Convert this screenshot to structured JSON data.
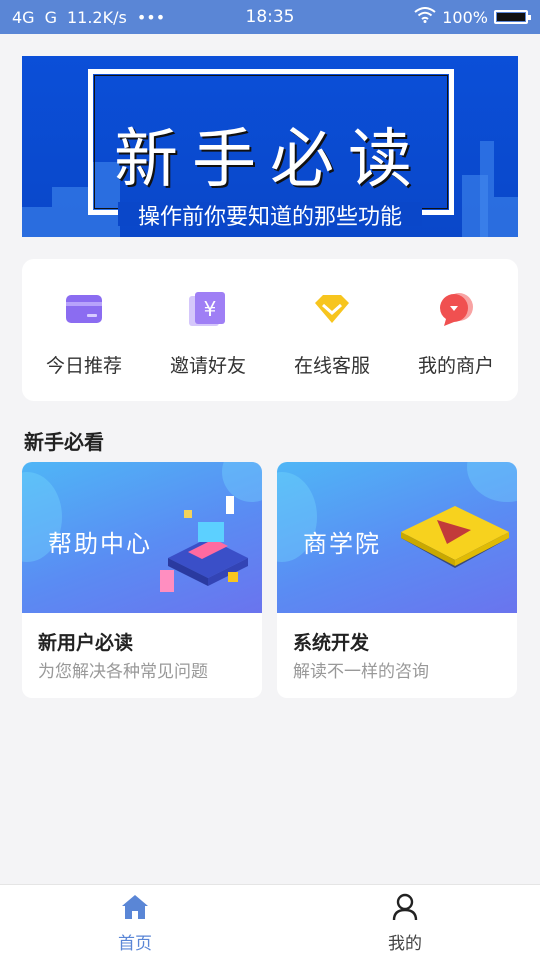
{
  "status_bar": {
    "signal_left": "4G",
    "signal_right": "G",
    "net_speed": "11.2K/s",
    "dots": "•••",
    "time": "18:35",
    "battery": "100%"
  },
  "banner": {
    "title": "新手必读",
    "subtitle": "操作前你要知道的那些功能"
  },
  "quick_menu": [
    {
      "label": "今日推荐",
      "icon": "card-icon",
      "color": "#8b6cf1"
    },
    {
      "label": "邀请好友",
      "icon": "yen-icon",
      "color": "#9f7ff5"
    },
    {
      "label": "在线客服",
      "icon": "diamond-icon",
      "color": "#f7c51e"
    },
    {
      "label": "我的商户",
      "icon": "shop-chat-icon",
      "color": "#f05050"
    }
  ],
  "section": {
    "title": "新手必看"
  },
  "guide_cards": [
    {
      "image_label": "帮助中心",
      "title": "新用户必读",
      "desc": "为您解决各种常见问题"
    },
    {
      "image_label": "商学院",
      "title": "系统开发",
      "desc": "解读不一样的咨询"
    }
  ],
  "tab_bar": {
    "home_label": "首页",
    "mine_label": "我的",
    "active_color": "#5a86d6"
  }
}
